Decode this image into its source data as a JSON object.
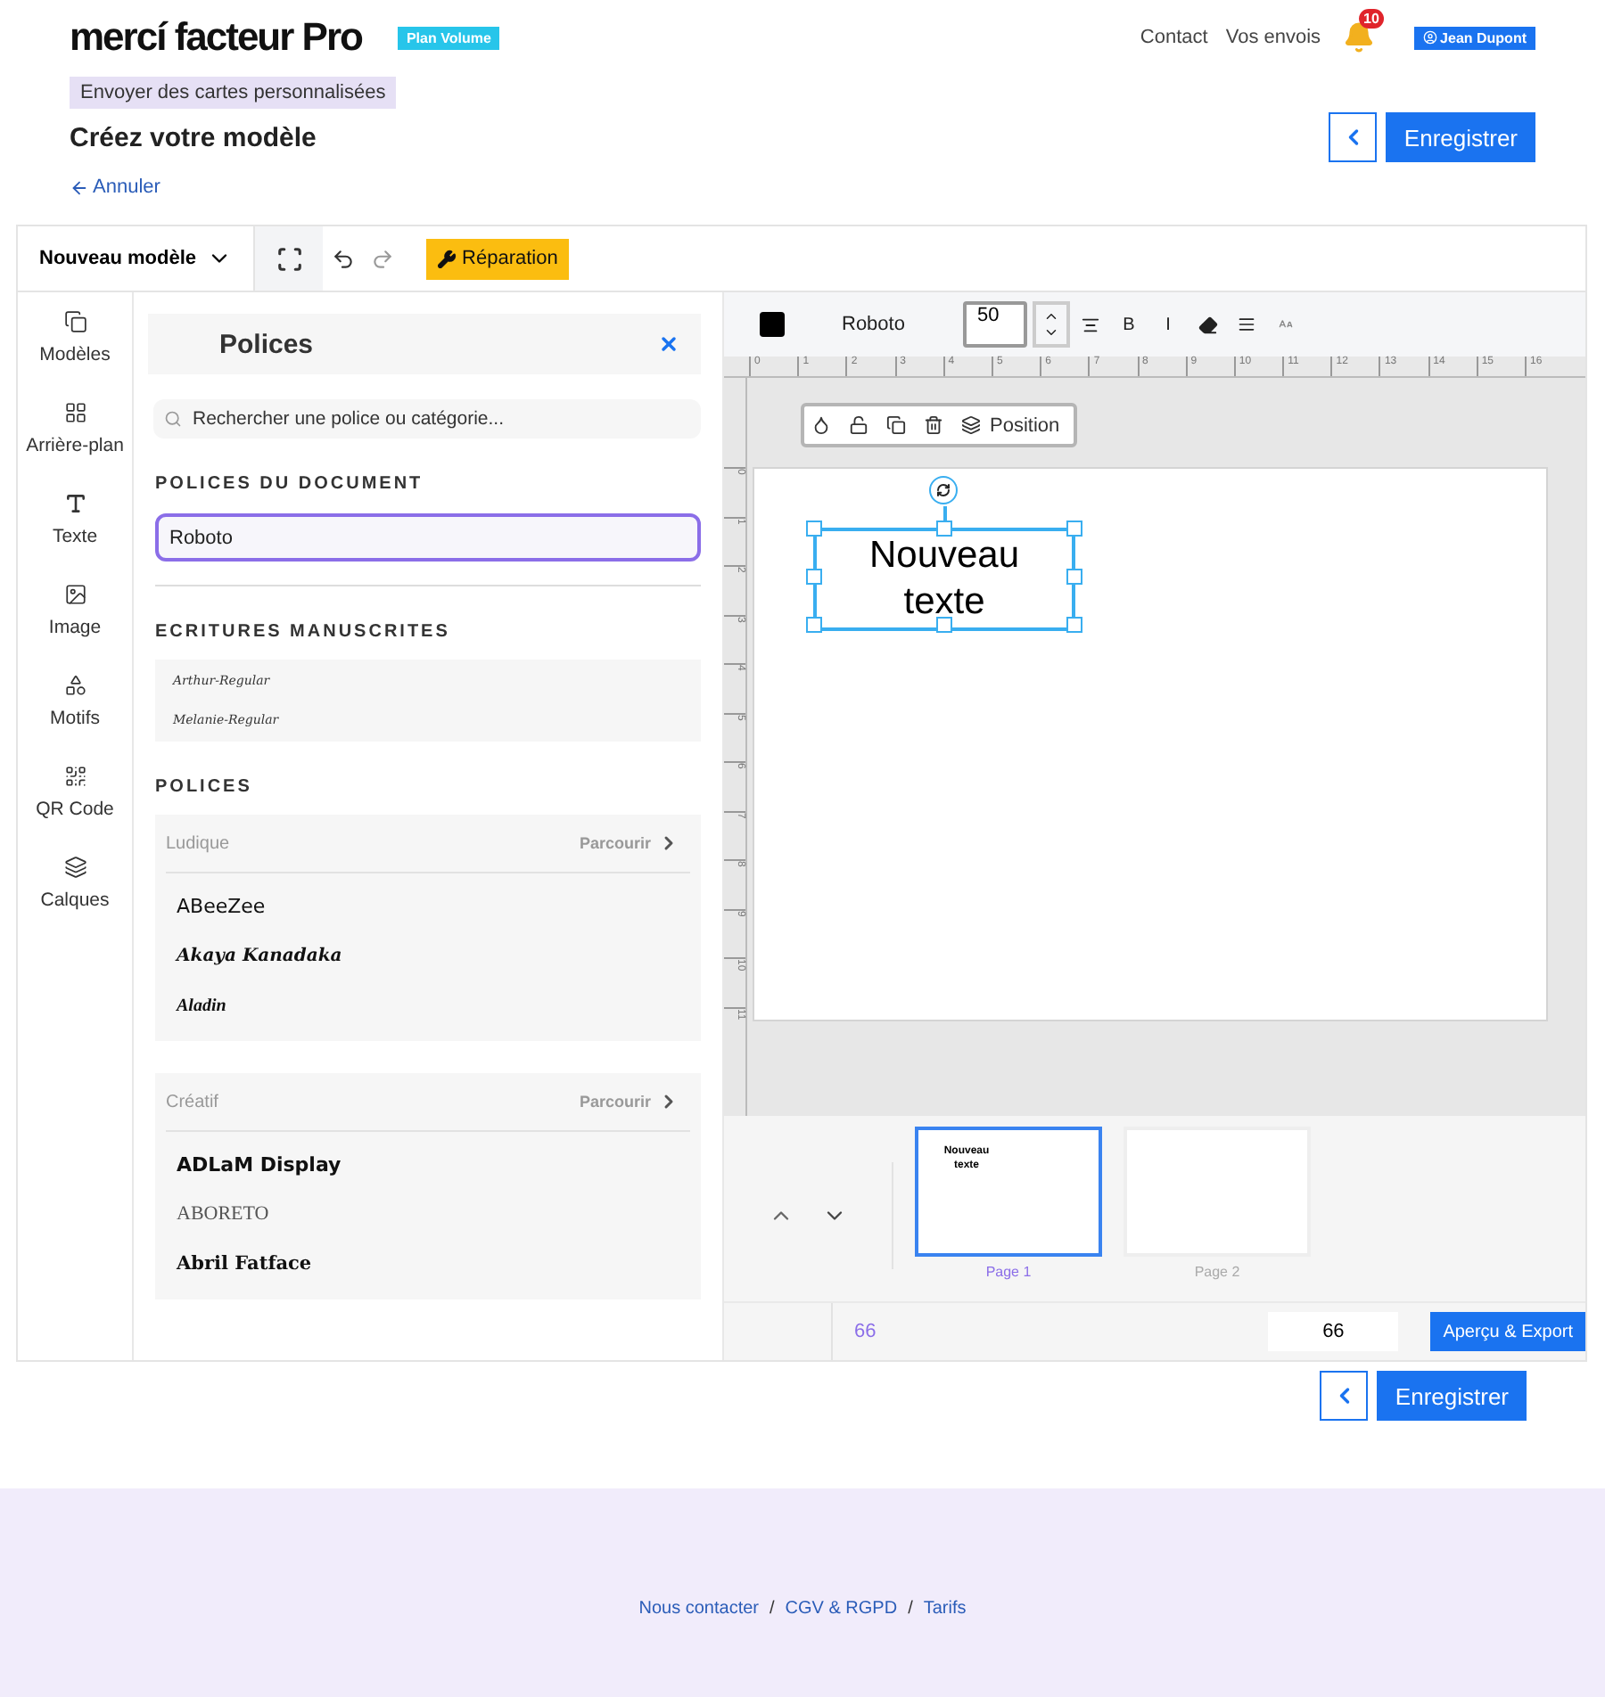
{
  "header": {
    "logo": "mercí facteur Pro",
    "plan": "Plan Volume",
    "nav": [
      "Contact",
      "Vos envois"
    ],
    "notifications": "10",
    "user": "Jean Dupont"
  },
  "intro": {
    "tag": "Envoyer des cartes personnalisées",
    "title": "Créez votre modèle",
    "cancel": "Annuler",
    "save": "Enregistrer"
  },
  "toolbar": {
    "model": "Nouveau modèle",
    "repair": "Réparation"
  },
  "rail": [
    {
      "kind": "models",
      "label": "Modèles"
    },
    {
      "kind": "background",
      "label": "Arrière-plan"
    },
    {
      "kind": "text",
      "label": "Texte"
    },
    {
      "kind": "image",
      "label": "Image"
    },
    {
      "kind": "shapes",
      "label": "Motifs"
    },
    {
      "kind": "qr",
      "label": "QR Code"
    },
    {
      "kind": "layers",
      "label": "Calques"
    }
  ],
  "fonts_panel": {
    "title": "Polices",
    "search": {
      "placeholder": "Rechercher une police ou catégorie..."
    },
    "document_heading": "POLICES DU DOCUMENT",
    "document_fonts": [
      {
        "name": "Roboto",
        "selected": true
      }
    ],
    "handwriting_heading": "ECRITURES MANUSCRITES",
    "handwriting": [
      "Arthur-Regular",
      "Melanie-Regular"
    ],
    "fonts_heading": "POLICES",
    "categories": [
      {
        "name": "Ludique",
        "browse": "Parcourir",
        "fonts": [
          {
            "name": "ABeeZee",
            "kind": "sans"
          },
          {
            "name": "Akaya Kanadaka",
            "kind": "script"
          },
          {
            "name": "Aladin",
            "kind": "display"
          }
        ]
      },
      {
        "name": "Créatif",
        "browse": "Parcourir",
        "fonts": [
          {
            "name": "ADLaM Display",
            "kind": "bold"
          },
          {
            "name": "ABORETO",
            "kind": "serif"
          },
          {
            "name": "Abril Fatface",
            "kind": "fatface"
          }
        ]
      }
    ]
  },
  "text_toolbar": {
    "color": "#000000",
    "font": "Roboto",
    "size": "50",
    "bold": "B",
    "italic": "I"
  },
  "ruler": {
    "horizontal": [
      "0",
      "1",
      "2",
      "3",
      "4",
      "5",
      "6",
      "7",
      "8",
      "9",
      "10",
      "11",
      "12",
      "13",
      "14",
      "15",
      "16"
    ],
    "vertical": [
      "0",
      "1",
      "2",
      "3",
      "4",
      "5",
      "6",
      "7",
      "8",
      "9",
      "10",
      "11"
    ]
  },
  "float_toolbar": {
    "position": "Position"
  },
  "canvas": {
    "text": "Nouveau texte"
  },
  "pages": [
    {
      "label": "Page 1",
      "selected": true,
      "text": "Nouveau texte"
    },
    {
      "label": "Page 2",
      "selected": false
    }
  ],
  "bottom_bar": {
    "zoom_label": "66",
    "zoom_value": "66",
    "export": "Aperçu & Export"
  },
  "bottom_actions": {
    "save": "Enregistrer"
  },
  "footer": [
    {
      "kind": "link",
      "text": "Nous contacter"
    },
    {
      "kind": "separator",
      "text": "/"
    },
    {
      "kind": "link",
      "text": "CGV & RGPD"
    },
    {
      "kind": "separator",
      "text": "/"
    },
    {
      "kind": "link",
      "text": "Tarifs"
    }
  ]
}
